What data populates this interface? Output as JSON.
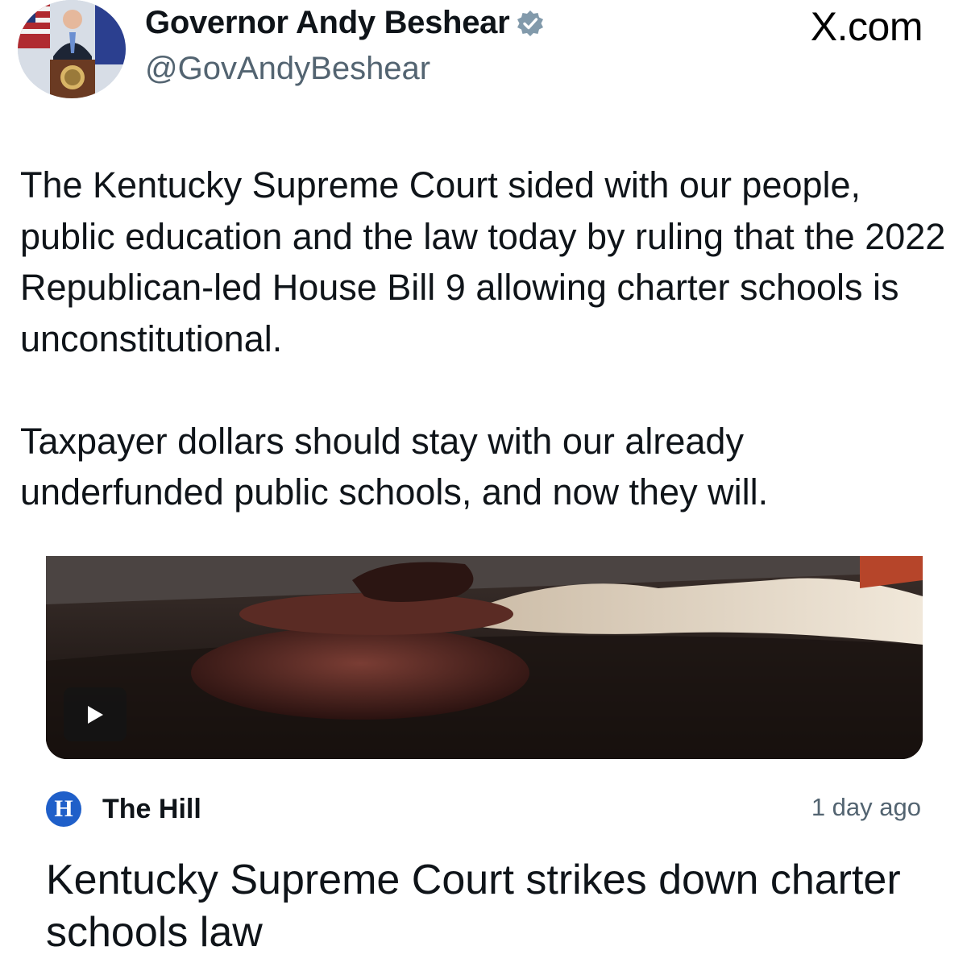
{
  "author": {
    "display_name": "Governor Andy Beshear",
    "handle": "@GovAndyBeshear",
    "verified": true,
    "avatar_icon": "avatar-photo"
  },
  "brand": "X.com",
  "tweet": {
    "paragraphs": [
      "The Kentucky Supreme Court sided with our people, public education and the law today by ruling that the 2022 Republican-led House Bill 9 allowing charter schools is unconstitutional.",
      "Taxpayer dollars should stay with our already underfunded public schools, and now they will."
    ]
  },
  "card": {
    "media_icon": "play-icon",
    "source_logo_letter": "H",
    "source_name": "The Hill",
    "timestamp": "1 day ago",
    "headline": "Kentucky Supreme Court strikes down charter schools law"
  },
  "colors": {
    "text": "#0f1419",
    "secondary_text": "#536471",
    "verified_badge": "#829aab",
    "source_logo_bg": "#1f5fc9"
  }
}
